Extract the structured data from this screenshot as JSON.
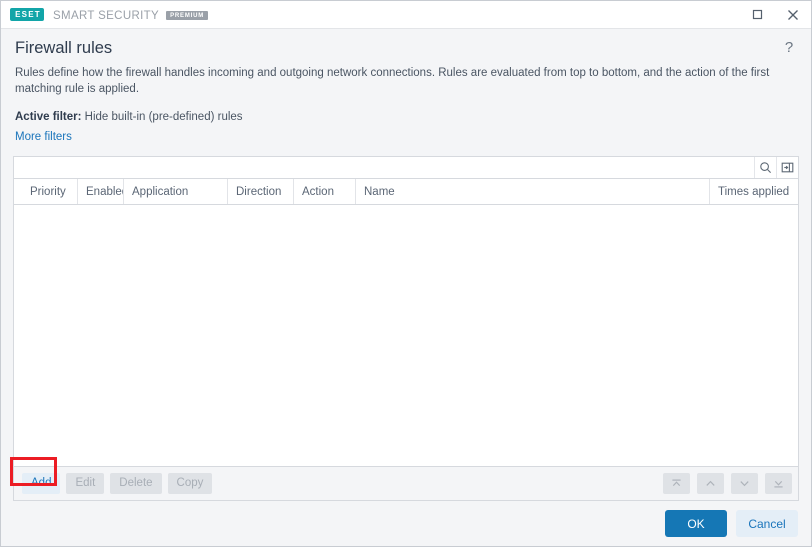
{
  "titlebar": {
    "logo_text": "ESET",
    "product": "SMART SECURITY",
    "edition_badge": "PREMIUM",
    "maximize_label": "Maximize",
    "close_label": "Close"
  },
  "header": {
    "title": "Firewall rules",
    "help_label": "?"
  },
  "description": "Rules define how the firewall handles incoming and outgoing network connections. Rules are evaluated from top to bottom, and the action of the first matching rule is applied.",
  "filter": {
    "label": "Active filter:",
    "value": "Hide built-in (pre-defined) rules",
    "more_filters": "More filters"
  },
  "search": {
    "value": "",
    "placeholder": ""
  },
  "table": {
    "columns": [
      "Priority",
      "Enabled",
      "Application",
      "Direction",
      "Action",
      "Name",
      "Times applied"
    ],
    "rows": []
  },
  "toolbar": {
    "add": "Add",
    "edit": "Edit",
    "delete": "Delete",
    "copy": "Copy",
    "move_top": "Move to top",
    "move_up": "Move up",
    "move_down": "Move down",
    "move_bottom": "Move to bottom"
  },
  "footer": {
    "ok": "OK",
    "cancel": "Cancel"
  },
  "colors": {
    "accent": "#1577b5",
    "link": "#1b75bb",
    "brand": "#12a5a8",
    "annotation": "#ec1c24"
  }
}
